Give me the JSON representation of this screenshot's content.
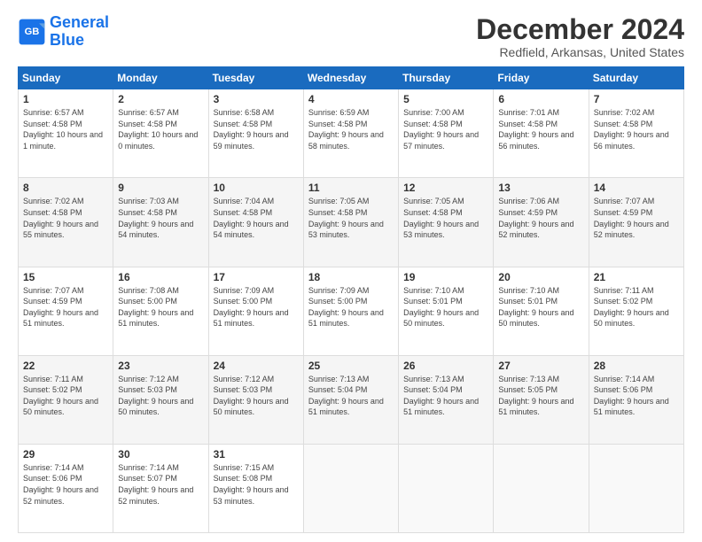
{
  "logo": {
    "line1": "General",
    "line2": "Blue"
  },
  "title": "December 2024",
  "subtitle": "Redfield, Arkansas, United States",
  "weekdays": [
    "Sunday",
    "Monday",
    "Tuesday",
    "Wednesday",
    "Thursday",
    "Friday",
    "Saturday"
  ],
  "weeks": [
    [
      {
        "day": "1",
        "sunrise": "6:57 AM",
        "sunset": "4:58 PM",
        "daylight": "10 hours and 1 minute."
      },
      {
        "day": "2",
        "sunrise": "6:57 AM",
        "sunset": "4:58 PM",
        "daylight": "10 hours and 0 minutes."
      },
      {
        "day": "3",
        "sunrise": "6:58 AM",
        "sunset": "4:58 PM",
        "daylight": "9 hours and 59 minutes."
      },
      {
        "day": "4",
        "sunrise": "6:59 AM",
        "sunset": "4:58 PM",
        "daylight": "9 hours and 58 minutes."
      },
      {
        "day": "5",
        "sunrise": "7:00 AM",
        "sunset": "4:58 PM",
        "daylight": "9 hours and 57 minutes."
      },
      {
        "day": "6",
        "sunrise": "7:01 AM",
        "sunset": "4:58 PM",
        "daylight": "9 hours and 56 minutes."
      },
      {
        "day": "7",
        "sunrise": "7:02 AM",
        "sunset": "4:58 PM",
        "daylight": "9 hours and 56 minutes."
      }
    ],
    [
      {
        "day": "8",
        "sunrise": "7:02 AM",
        "sunset": "4:58 PM",
        "daylight": "9 hours and 55 minutes."
      },
      {
        "day": "9",
        "sunrise": "7:03 AM",
        "sunset": "4:58 PM",
        "daylight": "9 hours and 54 minutes."
      },
      {
        "day": "10",
        "sunrise": "7:04 AM",
        "sunset": "4:58 PM",
        "daylight": "9 hours and 54 minutes."
      },
      {
        "day": "11",
        "sunrise": "7:05 AM",
        "sunset": "4:58 PM",
        "daylight": "9 hours and 53 minutes."
      },
      {
        "day": "12",
        "sunrise": "7:05 AM",
        "sunset": "4:58 PM",
        "daylight": "9 hours and 53 minutes."
      },
      {
        "day": "13",
        "sunrise": "7:06 AM",
        "sunset": "4:59 PM",
        "daylight": "9 hours and 52 minutes."
      },
      {
        "day": "14",
        "sunrise": "7:07 AM",
        "sunset": "4:59 PM",
        "daylight": "9 hours and 52 minutes."
      }
    ],
    [
      {
        "day": "15",
        "sunrise": "7:07 AM",
        "sunset": "4:59 PM",
        "daylight": "9 hours and 51 minutes."
      },
      {
        "day": "16",
        "sunrise": "7:08 AM",
        "sunset": "5:00 PM",
        "daylight": "9 hours and 51 minutes."
      },
      {
        "day": "17",
        "sunrise": "7:09 AM",
        "sunset": "5:00 PM",
        "daylight": "9 hours and 51 minutes."
      },
      {
        "day": "18",
        "sunrise": "7:09 AM",
        "sunset": "5:00 PM",
        "daylight": "9 hours and 51 minutes."
      },
      {
        "day": "19",
        "sunrise": "7:10 AM",
        "sunset": "5:01 PM",
        "daylight": "9 hours and 50 minutes."
      },
      {
        "day": "20",
        "sunrise": "7:10 AM",
        "sunset": "5:01 PM",
        "daylight": "9 hours and 50 minutes."
      },
      {
        "day": "21",
        "sunrise": "7:11 AM",
        "sunset": "5:02 PM",
        "daylight": "9 hours and 50 minutes."
      }
    ],
    [
      {
        "day": "22",
        "sunrise": "7:11 AM",
        "sunset": "5:02 PM",
        "daylight": "9 hours and 50 minutes."
      },
      {
        "day": "23",
        "sunrise": "7:12 AM",
        "sunset": "5:03 PM",
        "daylight": "9 hours and 50 minutes."
      },
      {
        "day": "24",
        "sunrise": "7:12 AM",
        "sunset": "5:03 PM",
        "daylight": "9 hours and 50 minutes."
      },
      {
        "day": "25",
        "sunrise": "7:13 AM",
        "sunset": "5:04 PM",
        "daylight": "9 hours and 51 minutes."
      },
      {
        "day": "26",
        "sunrise": "7:13 AM",
        "sunset": "5:04 PM",
        "daylight": "9 hours and 51 minutes."
      },
      {
        "day": "27",
        "sunrise": "7:13 AM",
        "sunset": "5:05 PM",
        "daylight": "9 hours and 51 minutes."
      },
      {
        "day": "28",
        "sunrise": "7:14 AM",
        "sunset": "5:06 PM",
        "daylight": "9 hours and 51 minutes."
      }
    ],
    [
      {
        "day": "29",
        "sunrise": "7:14 AM",
        "sunset": "5:06 PM",
        "daylight": "9 hours and 52 minutes."
      },
      {
        "day": "30",
        "sunrise": "7:14 AM",
        "sunset": "5:07 PM",
        "daylight": "9 hours and 52 minutes."
      },
      {
        "day": "31",
        "sunrise": "7:15 AM",
        "sunset": "5:08 PM",
        "daylight": "9 hours and 53 minutes."
      },
      null,
      null,
      null,
      null
    ]
  ],
  "labels": {
    "sunrise": "Sunrise:",
    "sunset": "Sunset:",
    "daylight": "Daylight:"
  }
}
